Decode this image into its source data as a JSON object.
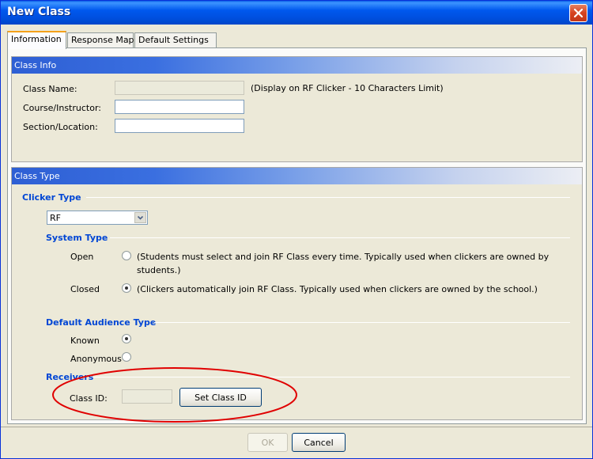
{
  "window": {
    "title": "New Class"
  },
  "tabs": [
    {
      "label": "Information"
    },
    {
      "label": "Response Map"
    },
    {
      "label": "Default Settings"
    }
  ],
  "class_info": {
    "header": "Class Info",
    "class_name_label": "Class Name:",
    "class_name_value": "",
    "class_name_hint": "(Display on RF Clicker - 10 Characters Limit)",
    "course_label": "Course/Instructor:",
    "course_value": "",
    "section_label": "Section/Location:",
    "section_value": ""
  },
  "class_type": {
    "header": "Class Type",
    "clicker_type_title": "Clicker Type",
    "clicker_type_value": "RF",
    "system_type_title": "System Type",
    "open_label": "Open",
    "open_desc": "(Students must select and join RF Class every time. Typically used when clickers are owned by students.)",
    "closed_label": "Closed",
    "closed_desc": "(Clickers automatically join RF Class. Typically used when clickers are owned by the school.)",
    "system_type_selected": "Closed",
    "audience_title": "Default Audience Type",
    "known_label": "Known",
    "anonymous_label": "Anonymous",
    "audience_selected": "Known",
    "receivers_title": "Receivers",
    "class_id_label": "Class ID:",
    "class_id_value": "",
    "set_class_id_label": "Set Class ID"
  },
  "footer": {
    "ok_label": "OK",
    "cancel_label": "Cancel"
  },
  "colors": {
    "title_bar": "#0058ee",
    "section_title": "#0046d5",
    "highlight": "#e00000"
  }
}
